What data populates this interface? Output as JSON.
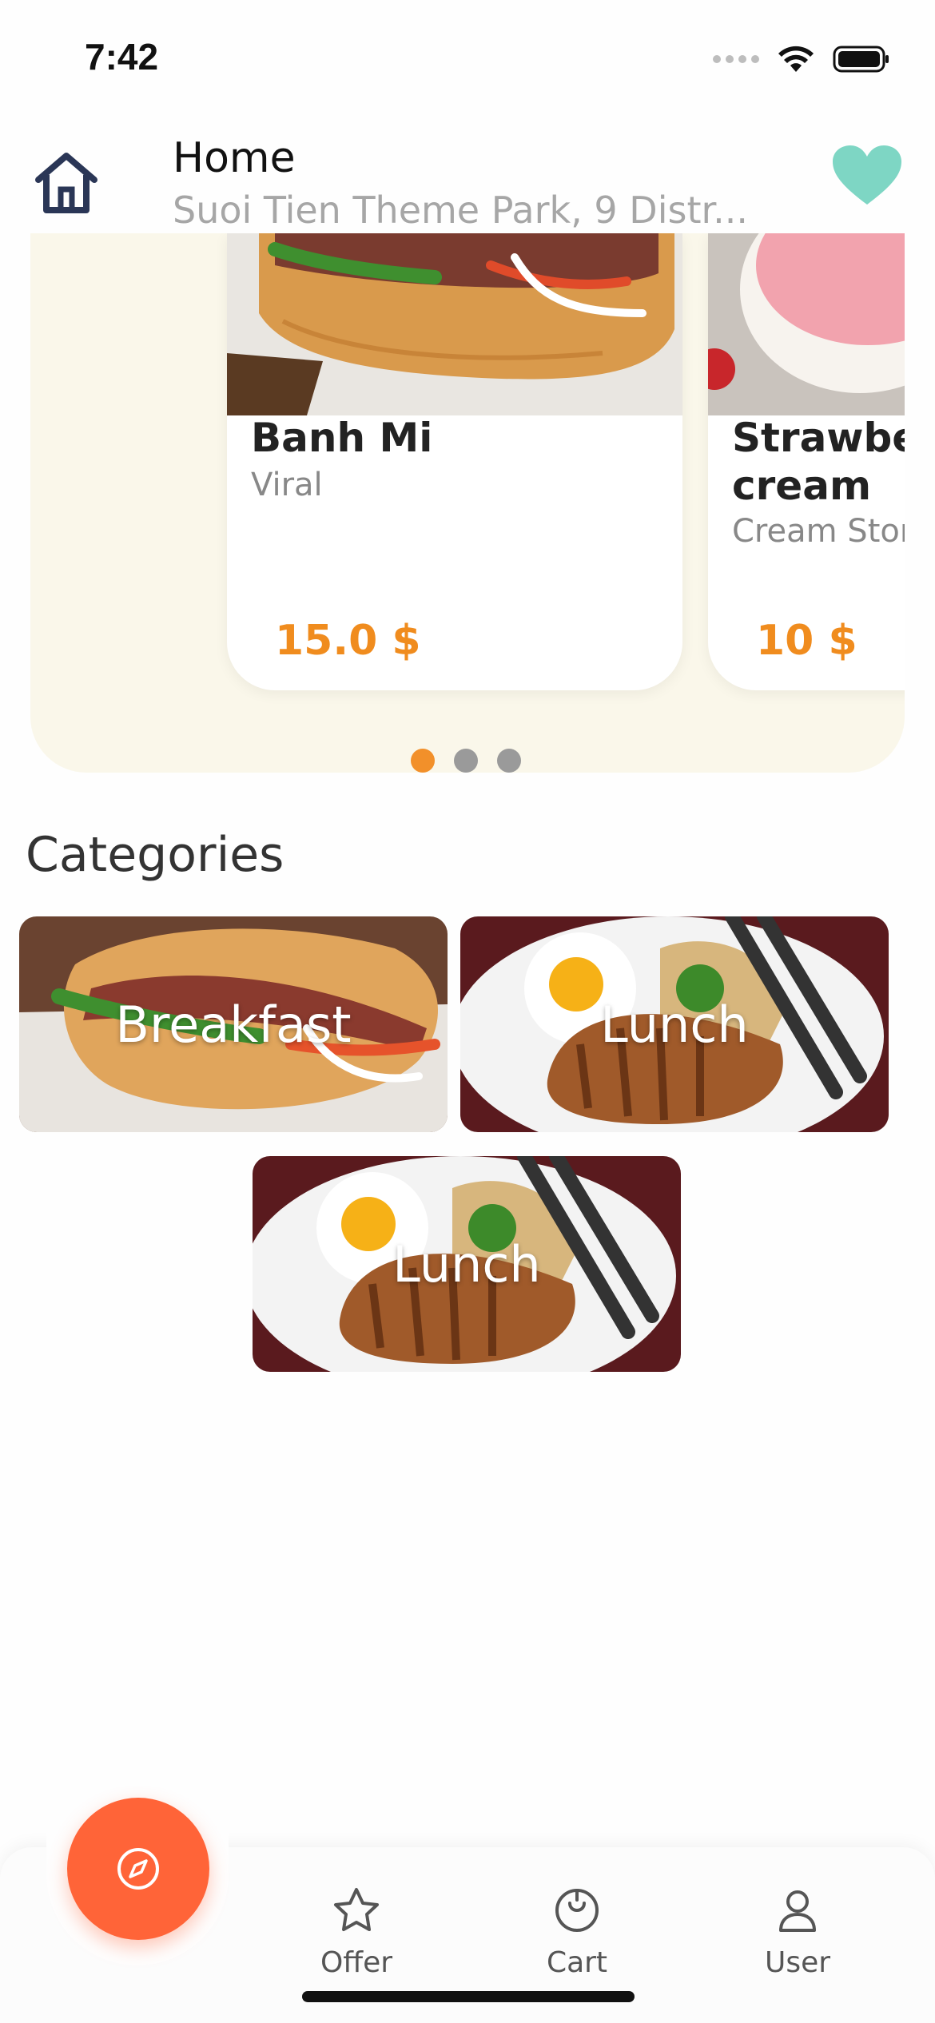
{
  "status_bar": {
    "time": "7:42"
  },
  "header": {
    "title": "Home",
    "location": "Suoi Tien Theme Park, 9 Distr..."
  },
  "featured": {
    "cards": [
      {
        "name": "Banh Mi",
        "subtitle": "Viral",
        "price": "15.0 $"
      },
      {
        "name_line1": "Strawber",
        "name_line2": "cream",
        "subtitle": "Cream Stor",
        "price": "10 $"
      }
    ],
    "page_count": 3,
    "active_page": 0
  },
  "categories": {
    "title": "Categories",
    "items": [
      {
        "label": "Breakfast",
        "image": "sandwich"
      },
      {
        "label": "Lunch",
        "image": "pork-chop-rice"
      },
      {
        "label": "Lunch",
        "image": "pork-chop-rice"
      }
    ]
  },
  "bottom_nav": {
    "fab_icon": "compass-icon",
    "items": [
      {
        "label": "Offer",
        "icon": "star-icon"
      },
      {
        "label": "Cart",
        "icon": "cart-clock-icon"
      },
      {
        "label": "User",
        "icon": "user-icon"
      }
    ]
  },
  "colors": {
    "accent_orange": "#f08c1e",
    "fab": "#ff6438",
    "heart": "#7ed6c4",
    "panel_bg": "#faf7ea"
  }
}
